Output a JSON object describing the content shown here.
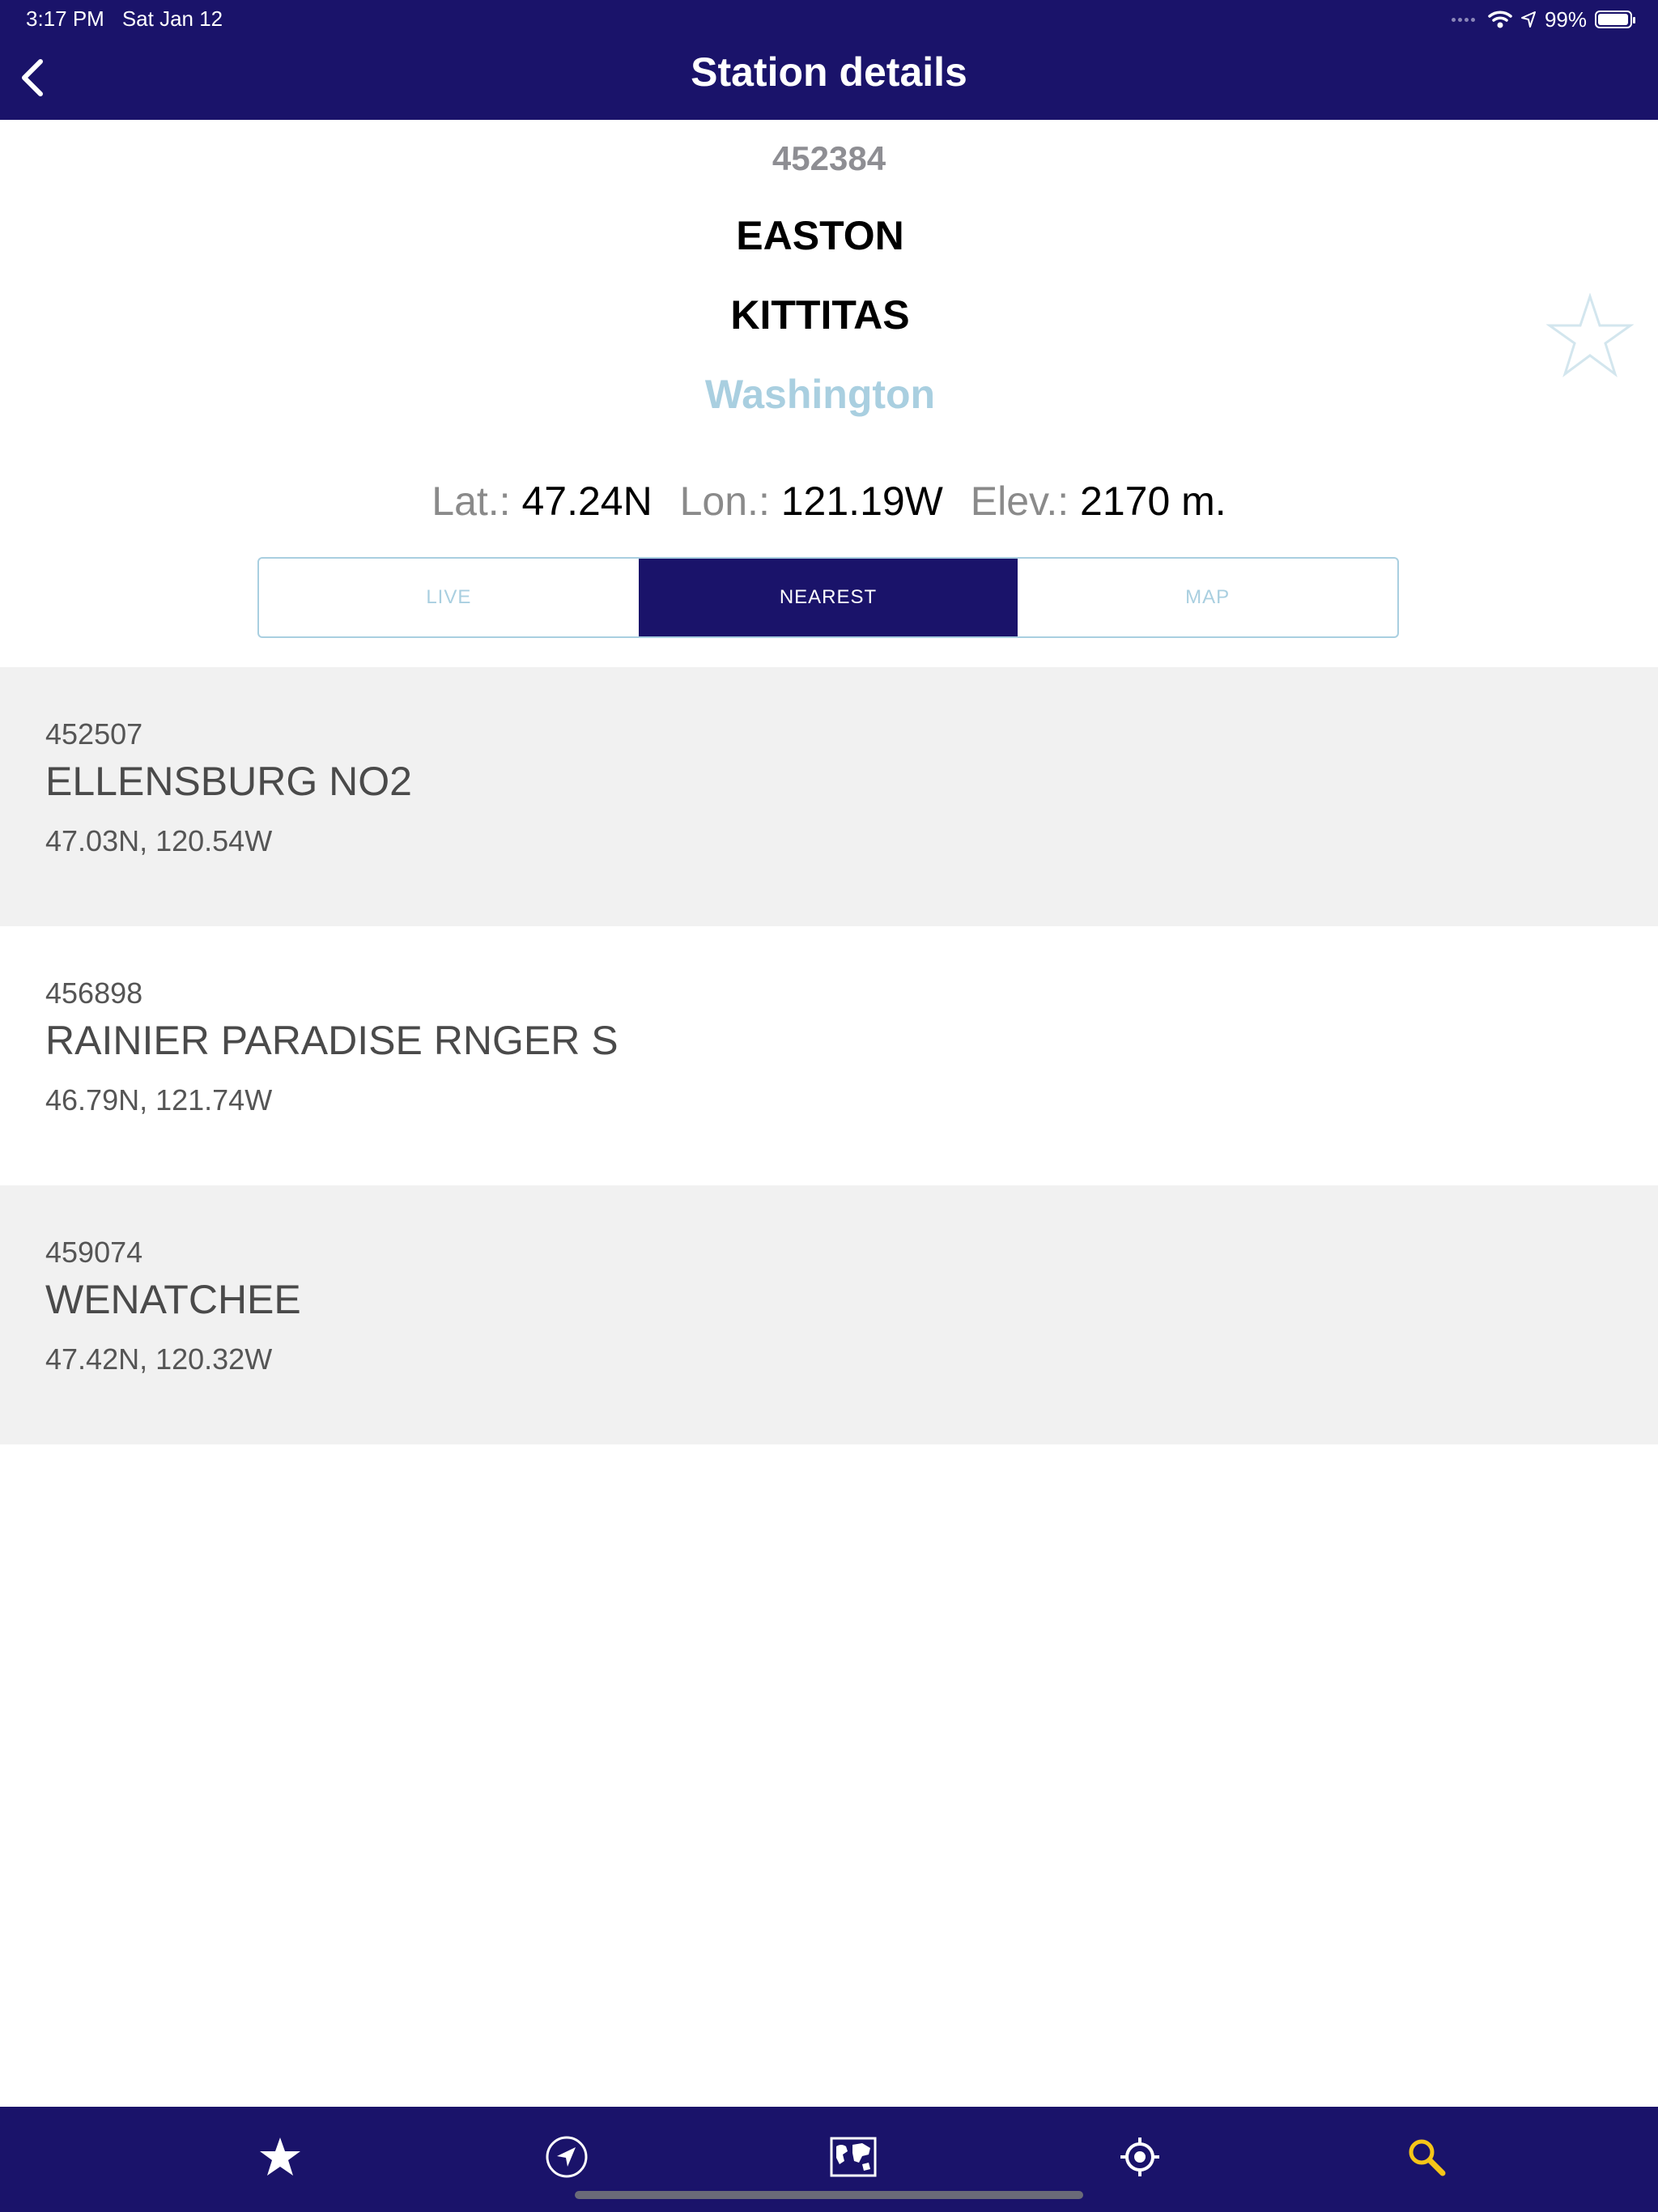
{
  "status_bar": {
    "time": "3:17 PM",
    "date": "Sat Jan 12",
    "battery": "99%"
  },
  "nav": {
    "title": "Station details",
    "back_icon": "chevron-left-icon"
  },
  "station": {
    "id": "452384",
    "name": "EASTON",
    "county": "KITTITAS",
    "state": "Washington",
    "favorite_icon": "star-outline-icon"
  },
  "coords": {
    "lat_label": "Lat.:",
    "lat_value": "47.24N",
    "lon_label": "Lon.:",
    "lon_value": "121.19W",
    "elev_label": "Elev.:",
    "elev_value": "2170 m."
  },
  "tabs": [
    {
      "label": "LIVE",
      "active": false
    },
    {
      "label": "NEAREST",
      "active": true
    },
    {
      "label": "MAP",
      "active": false
    }
  ],
  "nearest": [
    {
      "id": "452507",
      "name": "ELLENSBURG NO2",
      "coords": "47.03N, 120.54W"
    },
    {
      "id": "456898",
      "name": "RAINIER PARADISE RNGER S",
      "coords": "46.79N, 121.74W"
    },
    {
      "id": "459074",
      "name": "WENATCHEE",
      "coords": "47.42N, 120.32W"
    }
  ],
  "tabbar": {
    "items": [
      "star-icon",
      "navigation-arrow-icon",
      "world-map-icon",
      "location-target-icon",
      "search-icon"
    ],
    "active_color": "#f5c518",
    "bar_color": "#1a136a"
  }
}
